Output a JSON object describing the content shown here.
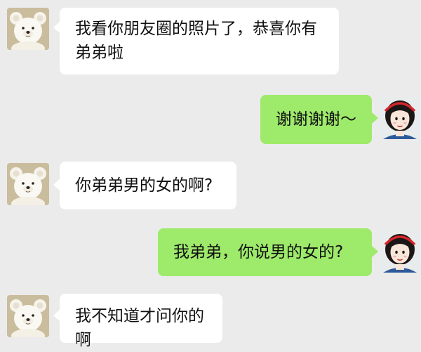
{
  "chat": {
    "messages": [
      {
        "sender": "contact",
        "text": "我看你朋友圈的照片了，恭喜你有弟弟啦"
      },
      {
        "sender": "me",
        "text": "谢谢谢谢～"
      },
      {
        "sender": "contact",
        "text": "你弟弟男的女的啊?"
      },
      {
        "sender": "me",
        "text": "我弟弟，你说男的女的?"
      },
      {
        "sender": "contact",
        "text": "我不知道才问你的啊"
      }
    ]
  },
  "icons": {
    "contact_avatar": "teddy-bear-icon",
    "my_avatar": "snow-white-icon"
  },
  "colors": {
    "background": "#ebebeb",
    "incoming_bubble": "#ffffff",
    "outgoing_bubble": "#9eea6a"
  }
}
